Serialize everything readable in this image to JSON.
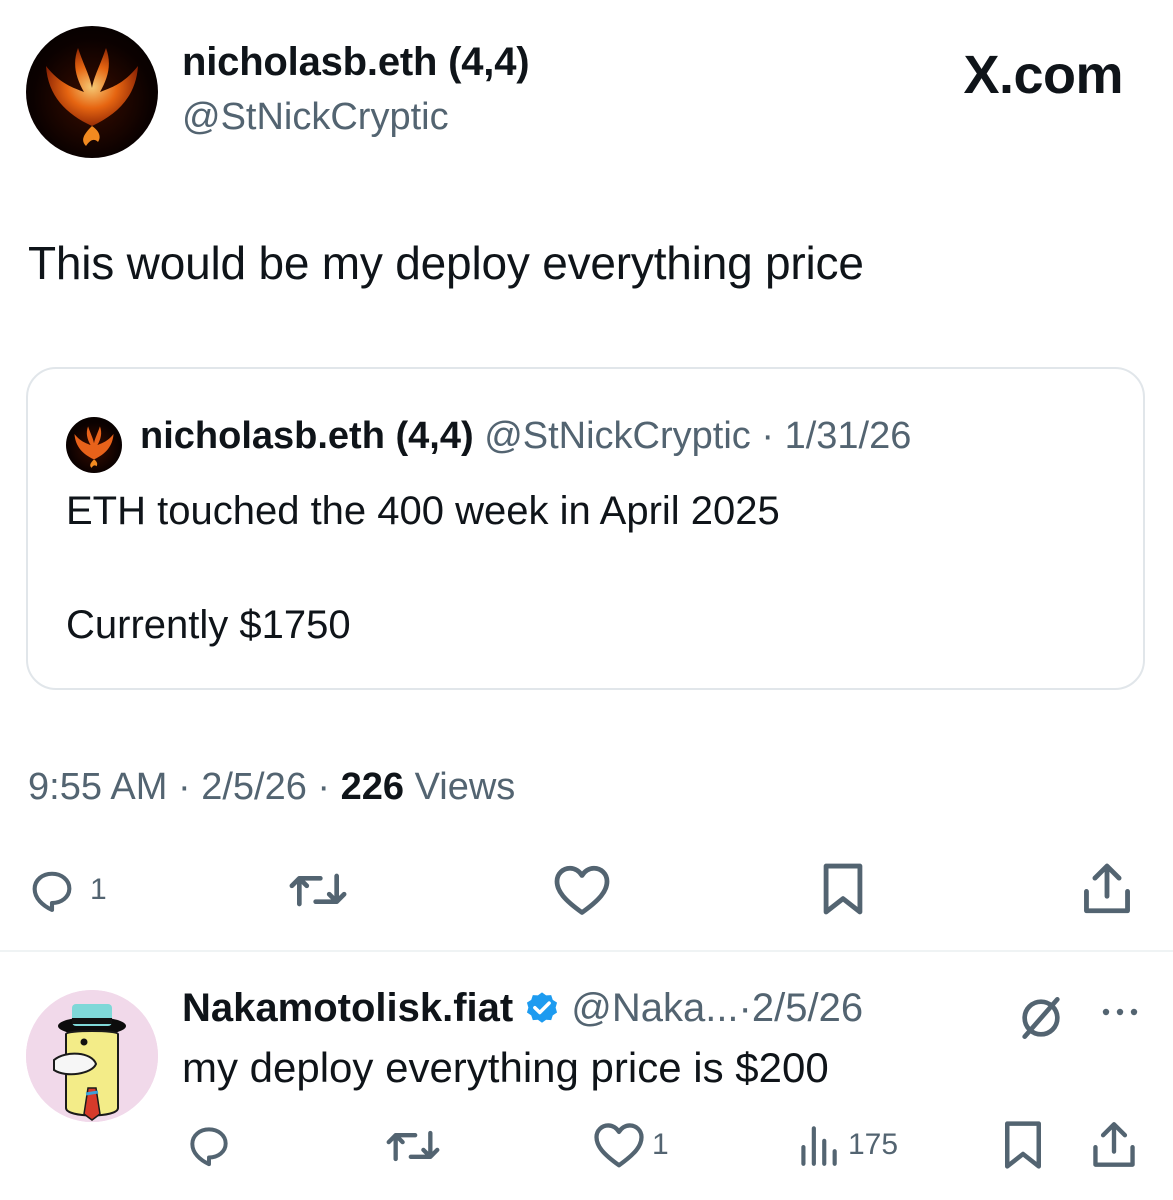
{
  "colors": {
    "text": "#0f1419",
    "secondary": "#536471",
    "border": "#e1e6ea",
    "verified": "#1d9bf0"
  },
  "tweet": {
    "author_name": "nicholasb.eth (4,4)",
    "author_handle": "@StNickCryptic",
    "brand": "X.com",
    "text": "This would be my deploy everything price",
    "quote": {
      "author_name": "nicholasb.eth (4,4)",
      "author_handle": "@StNickCryptic",
      "date": "1/31/26",
      "line1": "ETH touched the 400 week in April 2025",
      "line2": "Currently $1750"
    },
    "time": "9:55 AM",
    "date": "2/5/26",
    "views_count": "226",
    "views_label": "Views",
    "reply_count": "1",
    "icons": [
      "reply-icon",
      "retweet-icon",
      "like-icon",
      "bookmark-icon",
      "share-icon"
    ]
  },
  "reply": {
    "author_name": "Nakamotolisk.fiat",
    "author_handle": "@Naka...",
    "date": "2/5/26",
    "text": "my deploy everything price is $200",
    "like_count": "1",
    "views_count": "175",
    "icons": [
      "verified-badge-icon",
      "grok-icon",
      "more-icon",
      "reply-icon",
      "retweet-icon",
      "like-icon",
      "views-icon",
      "bookmark-icon",
      "share-icon"
    ]
  }
}
